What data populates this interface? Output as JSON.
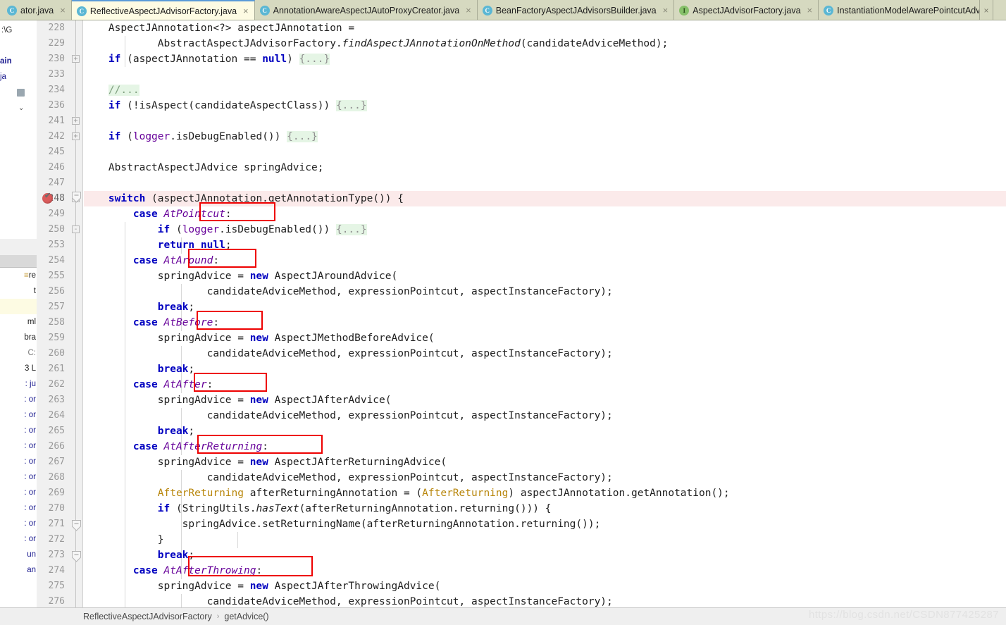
{
  "window": {
    "app": "IntelliJ IDEA",
    "file": "ReflectiveAspectJAdvisorFactory.java"
  },
  "tabs": [
    {
      "label": "ator.java",
      "icon": "class-icon",
      "kind": "cls",
      "active": false,
      "truncated": true,
      "close": "×"
    },
    {
      "label": "ReflectiveAspectJAdvisorFactory.java",
      "icon": "class-icon",
      "kind": "cls",
      "active": true,
      "truncated": false,
      "close": "×"
    },
    {
      "label": "AnnotationAwareAspectJAutoProxyCreator.java",
      "icon": "class-icon",
      "kind": "cls",
      "active": false,
      "truncated": false,
      "close": "×"
    },
    {
      "label": "BeanFactoryAspectJAdvisorsBuilder.java",
      "icon": "class-icon",
      "kind": "cls",
      "active": false,
      "truncated": false,
      "close": "×"
    },
    {
      "label": "AspectJAdvisorFactory.java",
      "icon": "interface-icon",
      "kind": "iface",
      "active": false,
      "truncated": false,
      "close": "×"
    },
    {
      "label": "InstantiationModelAwarePointcutAdvisorImpl.java",
      "icon": "class-icon",
      "kind": "cls",
      "active": false,
      "truncated": false,
      "close": "×"
    }
  ],
  "tabbar_right": {
    "close_label": "×",
    "more_label": "»"
  },
  "project_tree": [
    {
      "label": ":\\G",
      "indent": 0,
      "icon": "none"
    },
    {
      "label": "",
      "indent": 0,
      "icon": "none"
    },
    {
      "label": "ain",
      "indent": 0,
      "icon": "none"
    },
    {
      "label": "ja",
      "indent": 0,
      "icon": "none"
    },
    {
      "label": "",
      "indent": 1,
      "icon": "folder"
    },
    {
      "label": "",
      "indent": 1,
      "icon": "chevron"
    }
  ],
  "console_lines": [
    {
      "text": "re",
      "style": "dark"
    },
    {
      "text": "t",
      "style": "dark"
    },
    {
      "text": "",
      "style": "hl"
    },
    {
      "text": "ml",
      "style": "dark"
    },
    {
      "text": "bra",
      "style": "dark"
    },
    {
      "text": "C:",
      "style": "gray"
    },
    {
      "text": "3  L",
      "style": "dark"
    },
    {
      "text": ": ju",
      "style": "plain"
    },
    {
      "text": ": or",
      "style": "plain"
    },
    {
      "text": ": or",
      "style": "plain"
    },
    {
      "text": ": or",
      "style": "plain"
    },
    {
      "text": ": or",
      "style": "plain"
    },
    {
      "text": ": or",
      "style": "plain"
    },
    {
      "text": ": or",
      "style": "plain"
    },
    {
      "text": ": or",
      "style": "plain"
    },
    {
      "text": ": or",
      "style": "plain"
    },
    {
      "text": ": or",
      "style": "plain"
    },
    {
      "text": ": or",
      "style": "plain"
    },
    {
      "text": "un",
      "style": "plain"
    },
    {
      "text": "an",
      "style": "plain"
    }
  ],
  "editor": {
    "line_numbers": [
      "228",
      "229",
      "230",
      "233",
      "234",
      "236",
      "241",
      "242",
      "245",
      "246",
      "247",
      "248",
      "249",
      "250",
      "253",
      "254",
      "255",
      "256",
      "257",
      "258",
      "259",
      "260",
      "261",
      "262",
      "263",
      "264",
      "265",
      "266",
      "267",
      "268",
      "269",
      "270",
      "271",
      "272",
      "273",
      "274",
      "275",
      "276"
    ],
    "current_line": "248",
    "breakpoint_line": "248",
    "code_lines": [
      "    AspectJAnnotation<?> aspectJAnnotation =",
      "            AbstractAspectJAdvisorFactory.findAspectJAnnotationOnMethod(candidateAdviceMethod);",
      "    if (aspectJAnnotation == null) {...}",
      "",
      "    //...",
      "    if (!isAspect(candidateAspectClass)) {...}",
      "",
      "    if (logger.isDebugEnabled()) {...}",
      "",
      "    AbstractAspectJAdvice springAdvice;",
      "",
      "    switch (aspectJAnnotation.getAnnotationType()) {",
      "        case AtPointcut:",
      "            if (logger.isDebugEnabled()) {...}",
      "            return null;",
      "        case AtAround:",
      "            springAdvice = new AspectJAroundAdvice(",
      "                    candidateAdviceMethod, expressionPointcut, aspectInstanceFactory);",
      "            break;",
      "        case AtBefore:",
      "            springAdvice = new AspectJMethodBeforeAdvice(",
      "                    candidateAdviceMethod, expressionPointcut, aspectInstanceFactory);",
      "            break;",
      "        case AtAfter:",
      "            springAdvice = new AspectJAfterAdvice(",
      "                    candidateAdviceMethod, expressionPointcut, aspectInstanceFactory);",
      "            break;",
      "        case AtAfterReturning:",
      "            springAdvice = new AspectJAfterReturningAdvice(",
      "                    candidateAdviceMethod, expressionPointcut, aspectInstanceFactory);",
      "            AfterReturning afterReturningAnnotation = (AfterReturning) aspectJAnnotation.getAnnotation();",
      "            if (StringUtils.hasText(afterReturningAnnotation.returning())) {",
      "                springAdvice.setReturningName(afterReturningAnnotation.returning());",
      "            }",
      "            break;",
      "        case AtAfterThrowing:",
      "            springAdvice = new AspectJAfterThrowingAdvice(",
      "                    candidateAdviceMethod, expressionPointcut, aspectInstanceFactory);"
    ],
    "fold_markers": [
      "+",
      "+",
      "+",
      "+",
      "-",
      "-",
      "-"
    ],
    "annotations": [
      {
        "label": "AtPointcut",
        "line": "249"
      },
      {
        "label": "AtAround",
        "line": "254"
      },
      {
        "label": "AtBefore",
        "line": "258"
      },
      {
        "label": "AtAfter",
        "line": "262"
      },
      {
        "label": "AtAfterReturning",
        "line": "266"
      },
      {
        "label": "AtAfterThrowing",
        "line": "274"
      }
    ]
  },
  "breadcrumb": {
    "class": "ReflectiveAspectJAdvisorFactory",
    "separator": "›",
    "method": "getAdvice()"
  },
  "watermark": "https://blog.csdn.net/CSDN877425287",
  "colors": {
    "tab_active_bg": "#fdfbe3",
    "tab_bg": "#d6d9c0",
    "annotation_red": "#ee0000",
    "keyword_blue": "#0000c0",
    "constant_purple": "#660099",
    "annotation_gold": "#b8860b",
    "fold_green": "#e5f5e5",
    "current_line_pink": "#fbeaea",
    "breakpoint_red": "#db5c5c"
  }
}
